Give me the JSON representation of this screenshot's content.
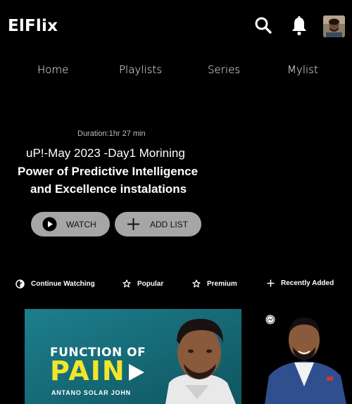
{
  "app": {
    "brand": "ElFlix"
  },
  "header": {
    "search_icon": "search-icon",
    "notification_icon": "bell-icon",
    "avatar_icon": "profile-avatar"
  },
  "nav": {
    "items": [
      {
        "label": "Home"
      },
      {
        "label": "Playlists"
      },
      {
        "label": "Series"
      },
      {
        "label": "Mylist"
      }
    ]
  },
  "hero": {
    "duration": "Duration:1hr 27 min",
    "title_line1": "uP!-May 2023 -Day1 Morining",
    "title_line2": "Power of Predictive Intelligence",
    "title_line3": "and Excellence instalations",
    "watch_label": "WATCH",
    "add_list_label": "ADD LIST"
  },
  "tabs": [
    {
      "label": "Continue Watching",
      "icon": "half-circle-icon"
    },
    {
      "label": "Popular",
      "icon": "star-outline-icon"
    },
    {
      "label": "Premium",
      "icon": "star-outline-icon"
    },
    {
      "label": "Recently Added",
      "icon": "plus-icon"
    }
  ],
  "cards": {
    "main": {
      "line1": "FUNCTION OF",
      "line2": "PAIN",
      "line3": "ANTANO SOLAR JOHN"
    }
  },
  "colors": {
    "background": "#000000",
    "button_bg": "#a6a6a6",
    "thumb_teal": "#1a6f7a",
    "thumb_yellow": "#f2e52b"
  }
}
